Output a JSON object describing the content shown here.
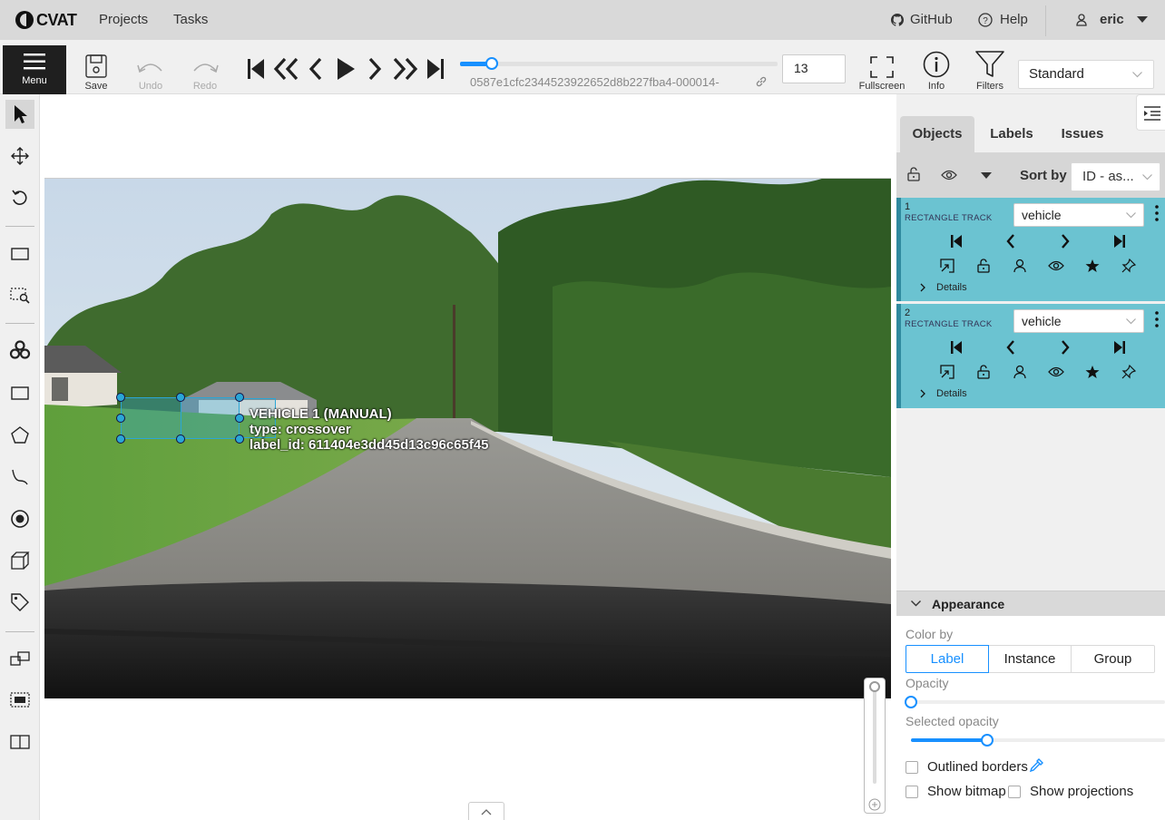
{
  "header": {
    "logo_text": "CVAT",
    "nav": [
      "Projects",
      "Tasks"
    ],
    "github_label": "GitHub",
    "help_label": "Help",
    "user": "eric"
  },
  "toolbar": {
    "menu_label": "Menu",
    "save_label": "Save",
    "undo_label": "Undo",
    "redo_label": "Redo",
    "frame_number": "13",
    "frame_progress_fraction": 0.1,
    "filename": "0587e1cfc2344523922652d8b227fba4-000014-",
    "fullscreen_label": "Fullscreen",
    "info_label": "Info",
    "filters_label": "Filters",
    "workspace": "Standard"
  },
  "annotation": {
    "title": "VEHICLE 1 (MANUAL)",
    "attr_type": "type: crossover",
    "attr_label_id": "label_id: 611404e3dd45d13c96c65f45"
  },
  "sidebar": {
    "tabs": [
      "Objects",
      "Labels",
      "Issues"
    ],
    "sort_label": "Sort by",
    "sort_value": "ID - as...",
    "objects": [
      {
        "id": "1",
        "type": "RECTANGLE TRACK",
        "label": "vehicle",
        "details": "Details"
      },
      {
        "id": "2",
        "type": "RECTANGLE TRACK",
        "label": "vehicle",
        "details": "Details"
      }
    ],
    "appearance": {
      "title": "Appearance",
      "color_by_label": "Color by",
      "color_by_options": [
        "Label",
        "Instance",
        "Group"
      ],
      "color_by_selected": "Label",
      "opacity_label": "Opacity",
      "opacity_value": 0.0,
      "selected_opacity_label": "Selected opacity",
      "selected_opacity_value": 0.3,
      "outlined_borders_label": "Outlined borders",
      "show_bitmap_label": "Show bitmap",
      "show_projections_label": "Show projections"
    }
  },
  "colors": {
    "accent": "#1890ff",
    "object_card": "#6bc3d1",
    "bbox": "#2aa6d6"
  }
}
